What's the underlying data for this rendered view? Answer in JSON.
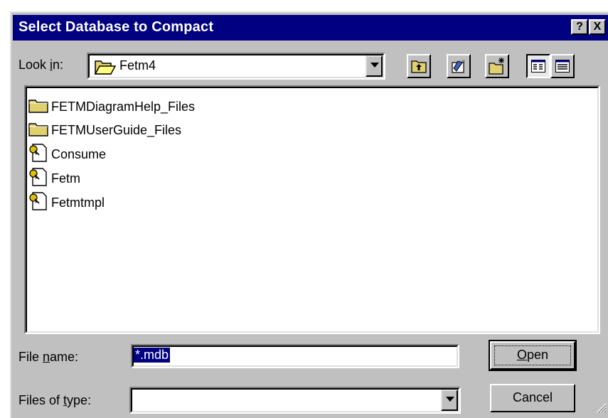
{
  "window": {
    "title": "Select Database to Compact",
    "help_button": "?",
    "close_button": "X"
  },
  "lookin": {
    "label_pre": "Look ",
    "label_accel": "i",
    "label_post": "n:",
    "folder": "Fetm4"
  },
  "files": [
    {
      "name": "FETMDiagramHelp_Files",
      "icon": "folder-icon"
    },
    {
      "name": "FETMUserGuide_Files",
      "icon": "folder-icon"
    },
    {
      "name": "Consume",
      "icon": "database-file-icon"
    },
    {
      "name": "Fetm",
      "icon": "database-file-icon"
    },
    {
      "name": "Fetmtmpl",
      "icon": "database-file-icon"
    }
  ],
  "filename": {
    "label_pre": "File ",
    "label_accel": "n",
    "label_post": "ame:",
    "value": "*.mdb"
  },
  "filetype": {
    "label_pre": "Files of ",
    "label_accel": "t",
    "label_post": "ype:",
    "value": ""
  },
  "buttons": {
    "open_accel": "O",
    "open_rest": "pen",
    "cancel": "Cancel"
  }
}
